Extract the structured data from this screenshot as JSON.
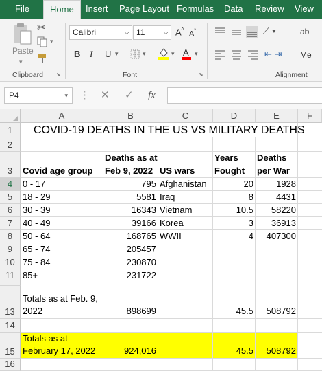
{
  "menu": {
    "tabs": [
      "File",
      "Home",
      "Insert",
      "Page Layout",
      "Formulas",
      "Data",
      "Review",
      "View"
    ]
  },
  "ribbon": {
    "clipboard": {
      "paste_label": "Paste",
      "group_label": "Clipboard"
    },
    "font": {
      "name": "Calibri",
      "size": "11",
      "increase_label": "A",
      "decrease_label": "A",
      "bold": "B",
      "italic": "I",
      "underline": "U",
      "group_label": "Font",
      "fill_color": "#ffff00",
      "font_color": "#ff0000"
    },
    "alignment": {
      "group_label": "Alignment",
      "wrap_prefix": "ab",
      "merge_prefix": "Me"
    }
  },
  "formula_bar": {
    "name_box": "P4",
    "fx_label": "fx",
    "value": ""
  },
  "columns": [
    "A",
    "B",
    "C",
    "D",
    "E",
    "F"
  ],
  "rows": [
    "1",
    "2",
    "3",
    "4",
    "5",
    "6",
    "7",
    "8",
    "9",
    "10",
    "11",
    "",
    "13",
    "14",
    "15",
    "16"
  ],
  "sheet": {
    "title": "COVID-19 DEATHS IN THE US VS MILITARY DEATHS",
    "headers": {
      "a": "Covid age group",
      "b1": "Deaths as at",
      "b2": "Feb 9, 2022",
      "c": "US wars",
      "d1": "Years",
      "d2": "Fought",
      "e1": "Deaths",
      "e2": "per War"
    },
    "data_rows": [
      {
        "age": "0 - 17",
        "deaths": "795",
        "war": "Afghanistan",
        "years": "20",
        "war_deaths": "1928"
      },
      {
        "age": "18 - 29",
        "deaths": "5581",
        "war": "Iraq",
        "years": "8",
        "war_deaths": "4431"
      },
      {
        "age": "30 - 39",
        "deaths": "16343",
        "war": "Vietnam",
        "years": "10.5",
        "war_deaths": "58220"
      },
      {
        "age": "40 - 49",
        "deaths": "39166",
        "war": "Korea",
        "years": "3",
        "war_deaths": "36913"
      },
      {
        "age": "50 - 64",
        "deaths": "168765",
        "war": "WWII",
        "years": "4",
        "war_deaths": "407300"
      },
      {
        "age": "65 - 74",
        "deaths": "205457",
        "war": "",
        "years": "",
        "war_deaths": ""
      },
      {
        "age": "75 - 84",
        "deaths": "230870",
        "war": "",
        "years": "",
        "war_deaths": ""
      },
      {
        "age": "85+",
        "deaths": "231722",
        "war": "",
        "years": "",
        "war_deaths": ""
      }
    ],
    "totals_feb9": {
      "line1": "Totals as at Feb. 9,",
      "line2": "2022",
      "deaths": "898699",
      "years": "45.5",
      "war_deaths": "508792"
    },
    "totals_feb17": {
      "line1": "Totals as at",
      "line2": "February 17, 2022",
      "deaths": "924,016",
      "years": "45.5",
      "war_deaths": "508792"
    },
    "highlight_color": "#ffff00"
  }
}
